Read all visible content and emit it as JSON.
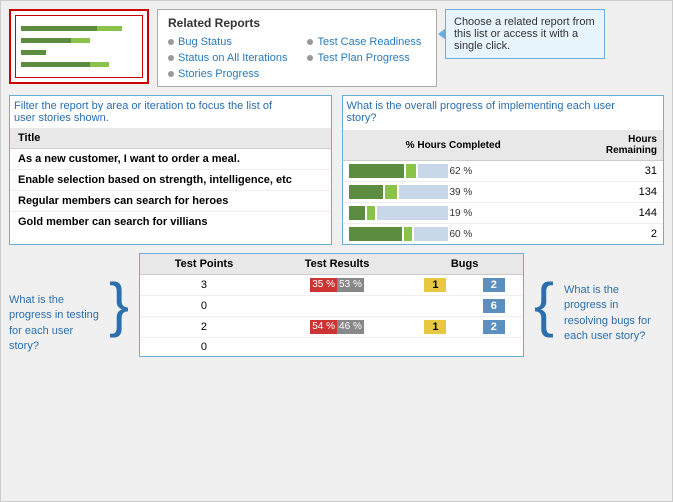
{
  "relatedReports": {
    "title": "Related Reports",
    "col1": [
      {
        "label": "Bug Status"
      },
      {
        "label": "Status on All Iterations"
      },
      {
        "label": "Stories Progress"
      }
    ],
    "col2": [
      {
        "label": "Test Case Readiness"
      },
      {
        "label": "Test Plan Progress"
      }
    ]
  },
  "callout": {
    "text": "Choose a related report from this list or access it with a single click."
  },
  "leftPanelCallout": "Filter the report by area or iteration to focus the list of user stories shown.",
  "rightPanelCallout": "What is the overall progress of implementing each user story?",
  "storiesTable": {
    "header": "Title",
    "rows": [
      "As a new customer, I want to order a meal.",
      "Enable selection based on strength, intelligence, etc",
      "Regular members can search for heroes",
      "Gold member can search for villians"
    ]
  },
  "progressTable": {
    "colHours": "% Hours Completed",
    "colRemaining": "Hours\nRemaining",
    "rows": [
      {
        "pct": 62,
        "label": "62 %",
        "remaining": "31"
      },
      {
        "pct": 39,
        "label": "39 %",
        "remaining": "134"
      },
      {
        "pct": 19,
        "label": "19 %",
        "remaining": "144"
      },
      {
        "pct": 60,
        "label": "60 %",
        "remaining": "2"
      }
    ]
  },
  "bottomLeftCallout": "What is the progress in testing for each user story?",
  "bottomRightCallout": "What is the progress in resolving bugs for each user story?",
  "testTable": {
    "cols": [
      "Test Points",
      "Test Results",
      "Bugs"
    ],
    "rows": [
      {
        "points": "3",
        "r1": "35 %",
        "r2": "53 %",
        "b1": "1",
        "b2": "2"
      },
      {
        "points": "0",
        "r1": "",
        "r2": "",
        "b1": "",
        "b2": "6"
      },
      {
        "points": "2",
        "r1": "54 %",
        "r2": "46 %",
        "b1": "1",
        "b2": "2"
      },
      {
        "points": "0",
        "r1": "",
        "r2": "",
        "b1": "",
        "b2": ""
      }
    ]
  }
}
